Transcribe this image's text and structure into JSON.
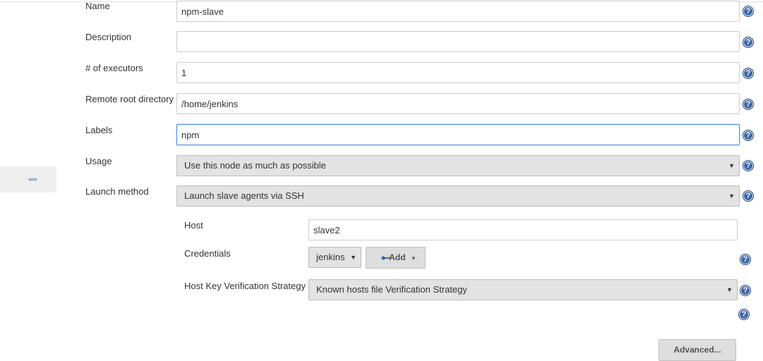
{
  "form": {
    "name": {
      "label": "Name",
      "value": "npm-slave"
    },
    "description": {
      "label": "Description",
      "value": ""
    },
    "executors": {
      "label": "# of executors",
      "value": "1"
    },
    "remote_root": {
      "label": "Remote root directory",
      "value": "/home/jenkins"
    },
    "labels": {
      "label": "Labels",
      "value": "npm"
    },
    "usage": {
      "label": "Usage",
      "selected": "Use this node as much as possible"
    },
    "launch_method": {
      "label": "Launch method",
      "selected": "Launch slave agents via SSH"
    }
  },
  "ssh": {
    "host": {
      "label": "Host",
      "value": "slave2"
    },
    "credentials": {
      "label": "Credentials",
      "selected": "jenkins",
      "add_label": "Add"
    },
    "host_key": {
      "label": "Host Key Verification Strategy",
      "selected": "Known hosts file Verification Strategy"
    },
    "advanced_label": "Advanced..."
  },
  "icons": {
    "help": "help-icon",
    "dropdown": "caret-down-icon",
    "key": "key-icon",
    "collapse": "minus-icon"
  },
  "glyphs": {
    "help": "?",
    "caret": "▼",
    "caret_small": "▼"
  },
  "colors": {
    "help_blue": "#3b67a6",
    "focus_border": "#4a90d9",
    "select_bg": "#e3e3e3"
  }
}
